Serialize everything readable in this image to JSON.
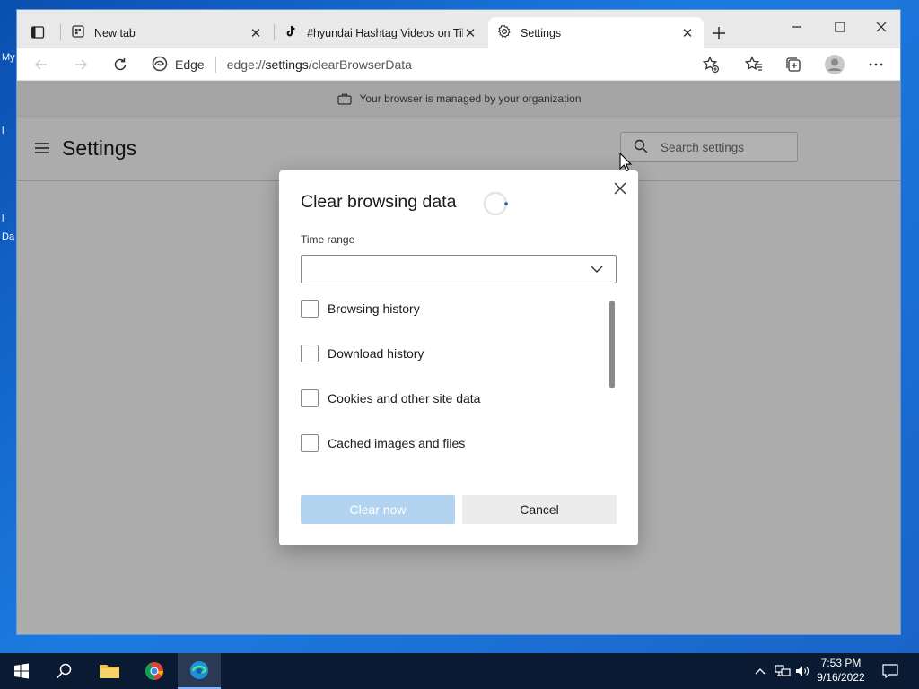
{
  "desktop": {
    "labels": [
      "My",
      "l",
      "l",
      "Da"
    ]
  },
  "tabs": [
    {
      "title": "New tab",
      "icon": "new-tab-page-icon"
    },
    {
      "title": "#hyundai Hashtag Videos on TikTok",
      "icon": "tiktok-icon"
    },
    {
      "title": "Settings",
      "icon": "gear-icon",
      "active": true
    }
  ],
  "toolbar": {
    "browser_label": "Edge",
    "url_scheme": "edge://",
    "url_host": "settings",
    "url_path": "/clearBrowserData"
  },
  "managed_bar": {
    "text": "Your browser is managed by your organization"
  },
  "settings": {
    "title": "Settings",
    "search_placeholder": "Search settings"
  },
  "dialog": {
    "title": "Clear browsing data",
    "time_range_label": "Time range",
    "time_range_value": "",
    "options": [
      {
        "label": "Browsing history",
        "checked": false
      },
      {
        "label": "Download history",
        "checked": false
      },
      {
        "label": "Cookies and other site data",
        "checked": false
      },
      {
        "label": "Cached images and files",
        "checked": false
      }
    ],
    "clear_label": "Clear now",
    "cancel_label": "Cancel"
  },
  "clock": {
    "time": "7:53 PM",
    "date": "9/16/2022"
  },
  "colors": {
    "accent": "#0067c0",
    "clear_disabled": "#b3d4f0"
  }
}
